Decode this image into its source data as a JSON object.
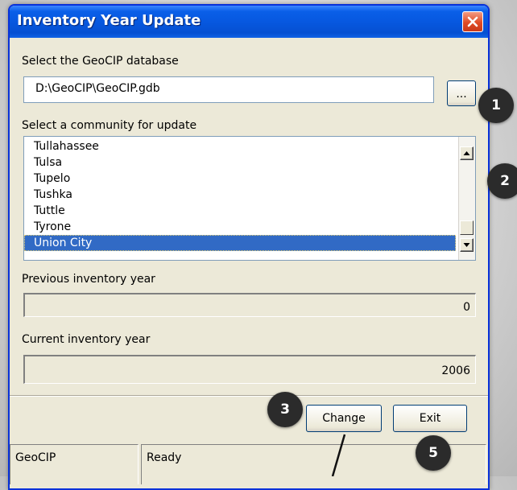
{
  "window": {
    "title": "Inventory Year Update"
  },
  "database": {
    "label": "Select the GeoCIP database",
    "path": "D:\\GeoCIP\\GeoCIP.gdb",
    "browse_label": "..."
  },
  "community": {
    "label": "Select a community for update",
    "items": [
      "Tullahassee",
      "Tulsa",
      "Tupelo",
      "Tushka",
      "Tuttle",
      "Tyrone",
      "Union City"
    ],
    "selected": "Union City"
  },
  "previous_year": {
    "label": "Previous inventory year",
    "value": "0"
  },
  "current_year": {
    "label": "Current inventory year",
    "value": "2006"
  },
  "buttons": {
    "change": "Change",
    "exit": "Exit"
  },
  "status": {
    "app": "GeoCIP",
    "message": "Ready"
  },
  "callouts": [
    "1",
    "2",
    "3",
    "5"
  ],
  "colors": {
    "titlebar": "#0758e0",
    "selection": "#316ac5",
    "badge": "#2b2b2b"
  }
}
